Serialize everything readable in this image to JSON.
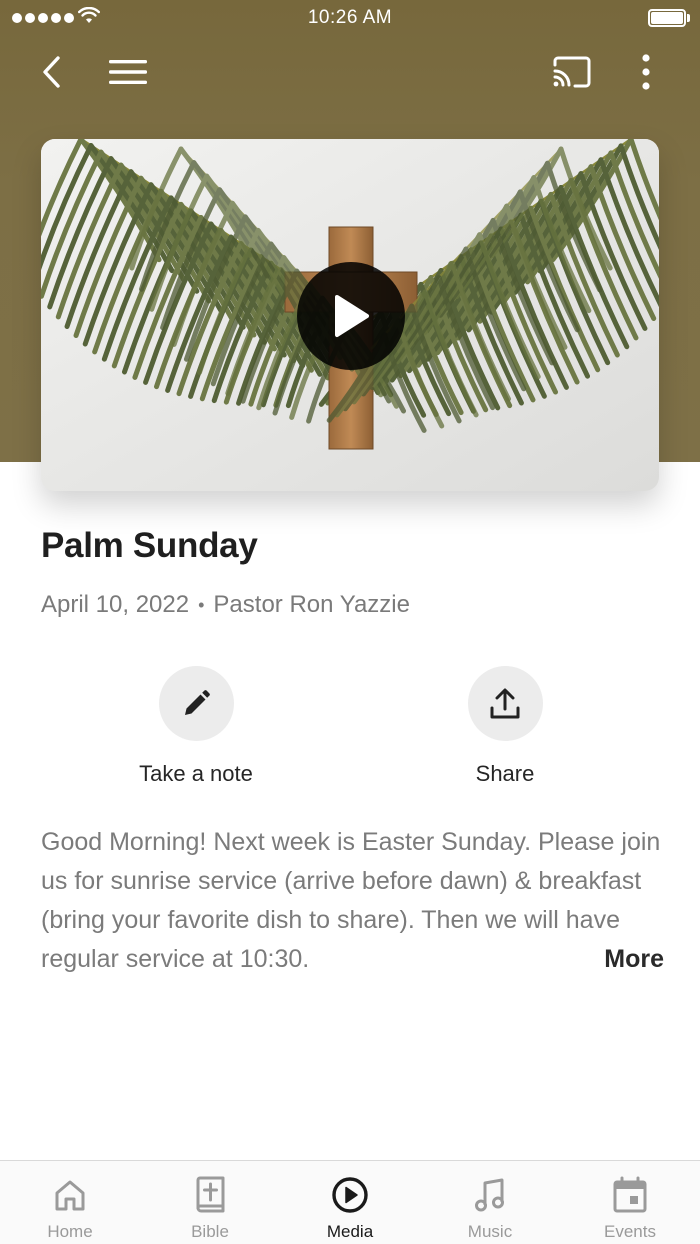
{
  "status_bar": {
    "time": "10:26 AM"
  },
  "nav": {
    "back_icon": "chevron-left-icon",
    "menu_icon": "hamburger-icon",
    "cast_icon": "cast-icon",
    "more_icon": "more-vertical-icon"
  },
  "colors": {
    "header": "#7e7047",
    "text_primary": "#1f1f1f",
    "text_secondary": "#7a7a7a",
    "action_circle": "#ececec"
  },
  "video": {
    "play_icon": "play-icon"
  },
  "sermon": {
    "title": "Palm Sunday",
    "date": "April 10, 2022",
    "separator": "•",
    "speaker": "Pastor Ron Yazzie"
  },
  "actions": [
    {
      "label": "Take a note",
      "icon": "pencil-icon"
    },
    {
      "label": "Share",
      "icon": "share-icon"
    }
  ],
  "description": {
    "text": "Good Morning! Next week is Easter Sunday. Please join us for sunrise service (arrive before dawn) & breakfast (bring your favorite dish to share). Then we will have regular service at 10:30.",
    "more_label": "More"
  },
  "tabs": [
    {
      "label": "Home",
      "icon": "home-icon",
      "active": false
    },
    {
      "label": "Bible",
      "icon": "bible-icon",
      "active": false
    },
    {
      "label": "Media",
      "icon": "play-circle-icon",
      "active": true
    },
    {
      "label": "Music",
      "icon": "music-note-icon",
      "active": false
    },
    {
      "label": "Events",
      "icon": "calendar-icon",
      "active": false
    }
  ]
}
